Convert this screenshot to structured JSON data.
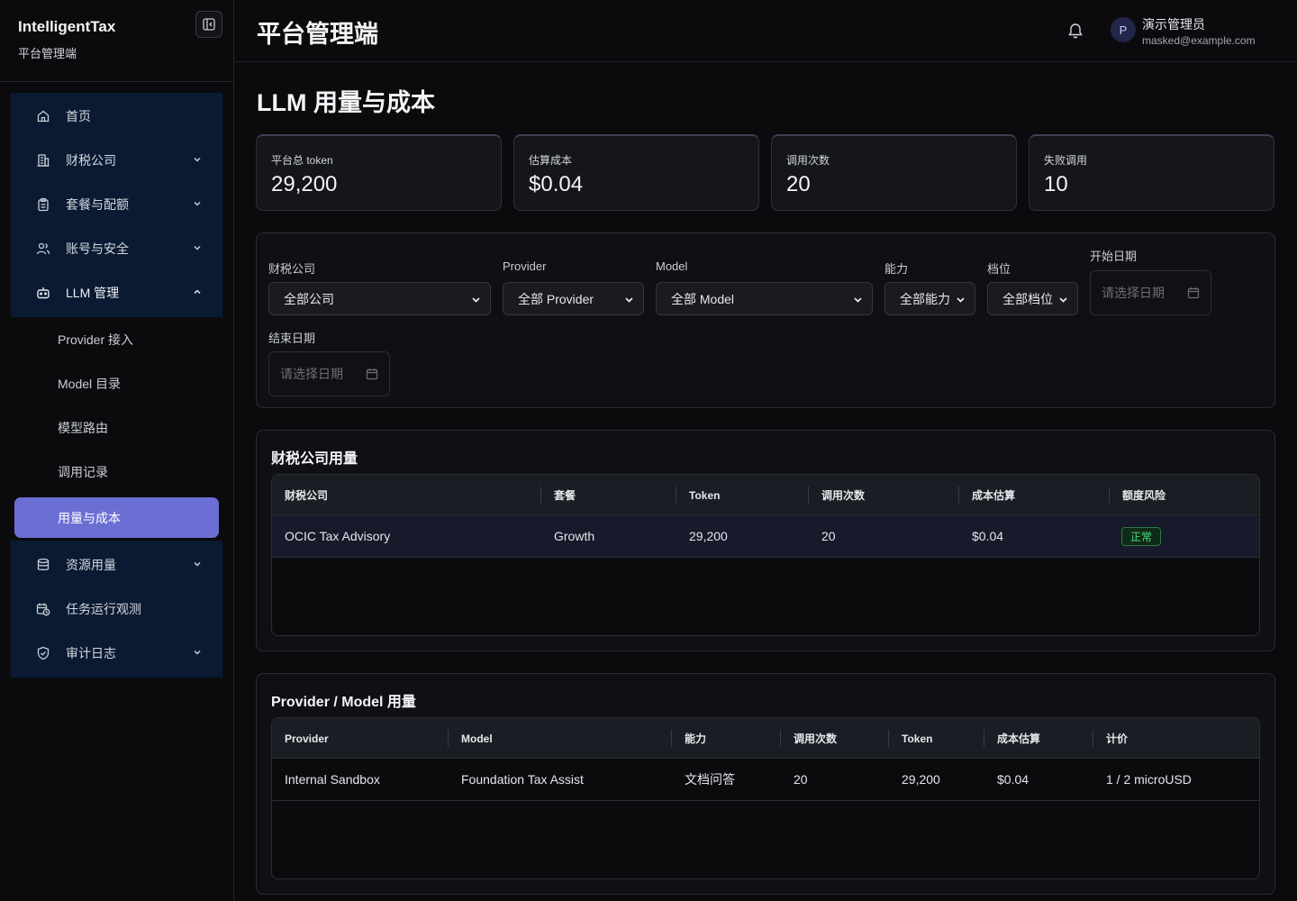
{
  "brand": {
    "title": "IntelligentTax",
    "subtitle": "平台管理端"
  },
  "sidebar": {
    "items": [
      {
        "label": "首页",
        "icon": "home-icon"
      },
      {
        "label": "财税公司",
        "icon": "building-icon"
      },
      {
        "label": "套餐与配额",
        "icon": "clipboard-icon"
      },
      {
        "label": "账号与安全",
        "icon": "users-icon"
      },
      {
        "label": "LLM 管理",
        "icon": "bot-icon"
      },
      {
        "label": "资源用量",
        "icon": "database-icon"
      },
      {
        "label": "任务运行观测",
        "icon": "calendar-clock-icon"
      },
      {
        "label": "审计日志",
        "icon": "shield-check-icon"
      }
    ],
    "llm_sub": [
      {
        "label": "Provider 接入"
      },
      {
        "label": "Model 目录"
      },
      {
        "label": "模型路由"
      },
      {
        "label": "调用记录"
      },
      {
        "label": "用量与成本"
      }
    ]
  },
  "header": {
    "title": "平台管理端",
    "user_initial": "P",
    "user_name": "演示管理员",
    "user_email": "masked@example.com"
  },
  "page": {
    "title": "LLM 用量与成本"
  },
  "stats": [
    {
      "label": "平台总 token",
      "value": "29,200"
    },
    {
      "label": "估算成本",
      "value": "$0.04"
    },
    {
      "label": "调用次数",
      "value": "20"
    },
    {
      "label": "失败调用",
      "value": "10"
    }
  ],
  "filters": {
    "company": {
      "label": "财税公司",
      "value": "全部公司"
    },
    "provider": {
      "label": "Provider",
      "value": "全部 Provider"
    },
    "model": {
      "label": "Model",
      "value": "全部 Model"
    },
    "capability": {
      "label": "能力",
      "value": "全部能力"
    },
    "tier": {
      "label": "档位",
      "value": "全部档位"
    },
    "start_date": {
      "label": "开始日期",
      "placeholder": "请选择日期"
    },
    "end_date": {
      "label": "结束日期",
      "placeholder": "请选择日期"
    }
  },
  "company_usage": {
    "title": "财税公司用量",
    "columns": [
      "财税公司",
      "套餐",
      "Token",
      "调用次数",
      "成本估算",
      "额度风险"
    ],
    "rows": [
      {
        "company": "OCIC Tax Advisory",
        "plan": "Growth",
        "token": "29,200",
        "calls": "20",
        "cost": "$0.04",
        "risk": "正常"
      }
    ],
    "risk_color": "#4ade80"
  },
  "provider_usage": {
    "title": "Provider / Model 用量",
    "columns": [
      "Provider",
      "Model",
      "能力",
      "调用次数",
      "Token",
      "成本估算",
      "计价"
    ],
    "rows": [
      {
        "provider": "Internal Sandbox",
        "model": "Foundation Tax Assist",
        "capability": "文档问答",
        "calls": "20",
        "token": "29,200",
        "cost": "$0.04",
        "pricing": "1 / 2 microUSD"
      }
    ]
  },
  "colors": {
    "accent": "#6b6fd4",
    "nav_bg": "#0a1a33"
  }
}
